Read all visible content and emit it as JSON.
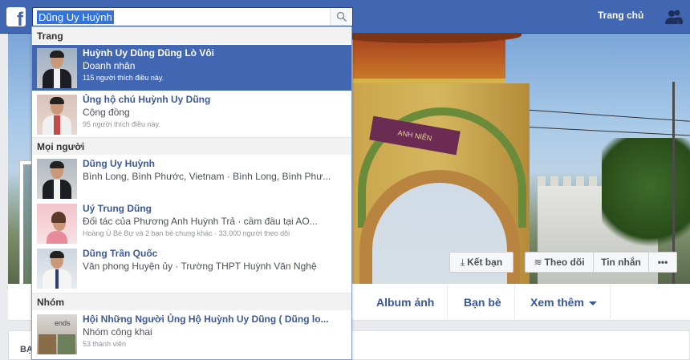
{
  "header": {
    "logo_letter": "f",
    "search_value": "Dũng Uy Huỳnh",
    "home_label": "Trang chủ"
  },
  "cover": {
    "plaque_text": "ANH  NIÊN"
  },
  "profile_actions": {
    "add_friend": "Kết bạn",
    "follow": "Theo dõi",
    "message": "Tin nhắn",
    "more": "•••"
  },
  "profile_tabs": {
    "albums": "Album ảnh",
    "friends": "Bạn bè",
    "more": "Xem thêm"
  },
  "about": {
    "label_fragment": "BẠ"
  },
  "dropdown": {
    "sections": {
      "pages": "Trang",
      "people": "Mọi người",
      "groups": "Nhóm"
    },
    "pages": [
      {
        "name": "Huỳnh Uy Dũng Dũng Lò Vôi",
        "subtitle": "Doanh nhân",
        "meta": "115 người thích điều này.",
        "highlighted": true
      },
      {
        "name": "Ủng hộ chú Huỳnh Uy Dũng",
        "subtitle": "Cộng đồng",
        "meta": "95 người thích điều này.",
        "highlighted": false
      }
    ],
    "people": [
      {
        "name": "Dũng Uy Huỳnh",
        "subtitle": "Bình Long, Bình Phước, Vietnam · Bình Long, Bình Phư...",
        "meta": ""
      },
      {
        "name": "Uý Trung Dũng",
        "subtitle": "Đối tác của Phương Anh Huỳnh Trả · cầm đầu tại AO...",
        "meta": "Hoàng Ú Bé Bự và 2 bạn bè chung khác · 33.000 người theo dõi"
      },
      {
        "name": "Dũng Trần Quốc",
        "subtitle": "Văn phong Huyện ủy · Trường THPT Huỳnh Văn Nghệ",
        "meta": ""
      }
    ],
    "groups": [
      {
        "name": "Hội Những Người Ủng Hộ Huỳnh Uy Dũng ( Dũng lo...",
        "subtitle": "Nhóm công khai",
        "meta": "53 thành viên",
        "thumb_text": "ends"
      }
    ]
  }
}
